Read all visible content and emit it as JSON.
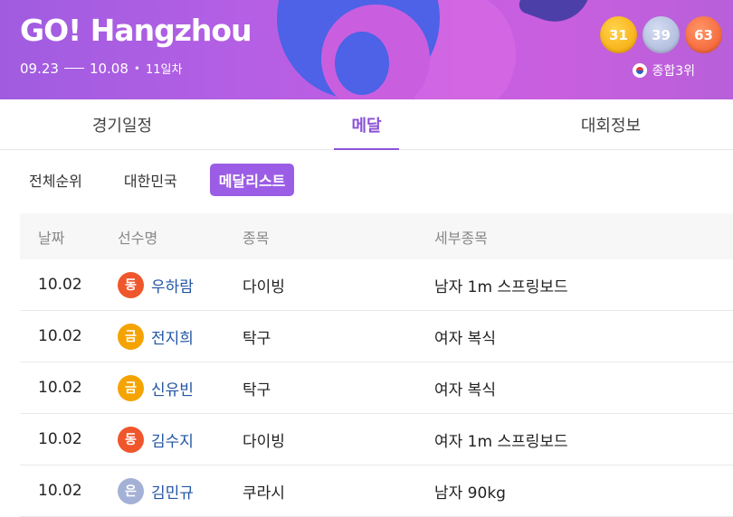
{
  "header": {
    "logo_prefix": "GO!",
    "logo_city": "Hangzhou",
    "date_start": "09.23",
    "date_end": "10.08",
    "day_label": "11일차",
    "medals": {
      "gold": "31",
      "silver": "39",
      "bronze": "63"
    },
    "rank_label": "종합3위"
  },
  "tabs": [
    {
      "label": "경기일정"
    },
    {
      "label": "메달"
    },
    {
      "label": "대회정보"
    }
  ],
  "subtabs": [
    {
      "label": "전체순위"
    },
    {
      "label": "대한민국"
    },
    {
      "label": "메달리스트"
    }
  ],
  "table": {
    "headers": [
      "날짜",
      "선수명",
      "종목",
      "세부종목"
    ],
    "rows": [
      {
        "date": "10.02",
        "medal": "동",
        "medal_type": "bronze",
        "athlete": "우하람",
        "sport": "다이빙",
        "event": "남자 1m 스프링보드"
      },
      {
        "date": "10.02",
        "medal": "금",
        "medal_type": "gold",
        "athlete": "전지희",
        "sport": "탁구",
        "event": "여자 복식"
      },
      {
        "date": "10.02",
        "medal": "금",
        "medal_type": "gold",
        "athlete": "신유빈",
        "sport": "탁구",
        "event": "여자 복식"
      },
      {
        "date": "10.02",
        "medal": "동",
        "medal_type": "bronze",
        "athlete": "김수지",
        "sport": "다이빙",
        "event": "여자 1m 스프링보드"
      },
      {
        "date": "10.02",
        "medal": "은",
        "medal_type": "silver",
        "athlete": "김민규",
        "sport": "쿠라시",
        "event": "남자 90kg"
      }
    ]
  },
  "colors": {
    "accent": "#8b52d6",
    "gold": "#f5a300",
    "silver": "#a4b1d6",
    "bronze": "#f0562b"
  }
}
